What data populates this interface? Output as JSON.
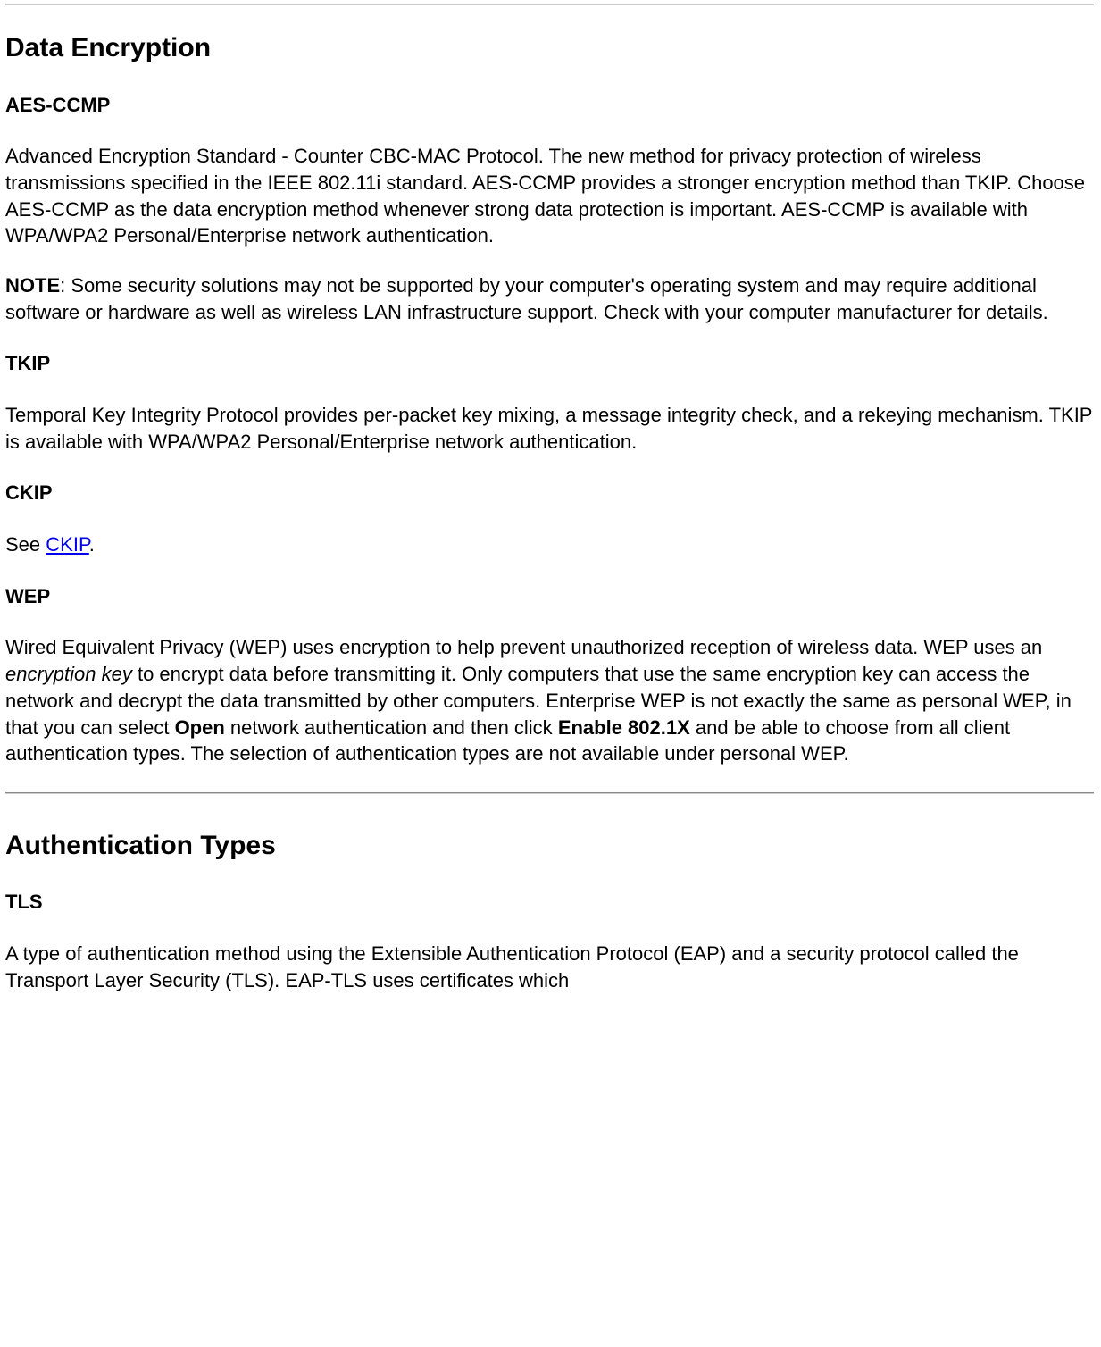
{
  "section1": {
    "heading": "Data Encryption",
    "aesccmp": {
      "title": "AES-CCMP",
      "body": "Advanced Encryption Standard - Counter CBC-MAC Protocol. The new method for privacy protection of wireless transmissions specified in the IEEE 802.11i standard. AES-CCMP provides a stronger encryption method than TKIP. Choose AES-CCMP as the data encryption method whenever strong data protection is important. AES-CCMP is available with WPA/WPA2 Personal/Enterprise network authentication."
    },
    "note": {
      "label": "NOTE",
      "body": ": Some security solutions may not be supported by your computer's operating system and may require additional software or hardware as well as wireless LAN infrastructure support. Check with your computer manufacturer for details."
    },
    "tkip": {
      "title": "TKIP",
      "body": "Temporal Key Integrity Protocol provides per-packet key mixing, a message integrity check, and a rekeying mechanism. TKIP is available with WPA/WPA2 Personal/Enterprise network authentication."
    },
    "ckip": {
      "title": "CKIP",
      "body_prefix": "See ",
      "link": "CKIP",
      "body_suffix": "."
    },
    "wep": {
      "title": "WEP",
      "body_part1": "Wired Equivalent Privacy (WEP) uses encryption to help prevent unauthorized reception of wireless data. WEP uses an ",
      "italic1": "encryption key",
      "body_part2": " to encrypt data before transmitting it. Only computers that use the same encryption key can access the network and decrypt the data transmitted by other computers. Enterprise WEP is not exactly the same as personal WEP, in that you can select ",
      "bold1": "Open",
      "body_part3": " network authentication and then click ",
      "bold2": "Enable 802.1X",
      "body_part4": " and be able to choose from all client authentication types. The selection of authentication types are not available under personal WEP."
    }
  },
  "section2": {
    "heading": "Authentication Types",
    "tls": {
      "title": "TLS",
      "body": "A type of authentication method using the Extensible Authentication Protocol (EAP) and a security protocol called the Transport Layer Security (TLS). EAP-TLS uses certificates which"
    }
  }
}
